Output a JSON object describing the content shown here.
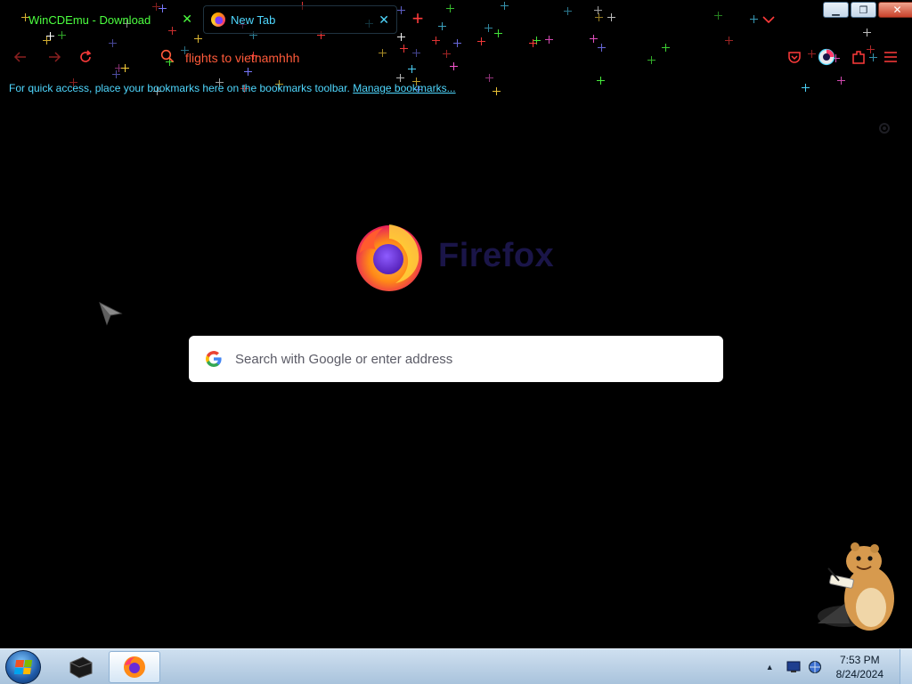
{
  "tabs": [
    {
      "title": "WinCDEmu - Download",
      "active": false
    },
    {
      "title": "New Tab",
      "active": true
    }
  ],
  "window_controls": {
    "minimize": "minimize",
    "restore": "restore",
    "close": "close"
  },
  "navbar": {
    "url_value": "flights to vietnamhhh"
  },
  "bookmarks_bar": {
    "message": "For quick access, place your bookmarks here on the bookmarks toolbar.",
    "link_label": "Manage bookmarks..."
  },
  "newtab": {
    "brand": "Firefox",
    "search_placeholder": "Search with Google or enter address"
  },
  "taskbar": {
    "time": "7:53 PM",
    "date": "8/24/2024"
  },
  "colors": {
    "accent_red": "#ff3b3b",
    "tab_cyan": "#4fd8ff",
    "tab_green": "#4cff3f"
  }
}
